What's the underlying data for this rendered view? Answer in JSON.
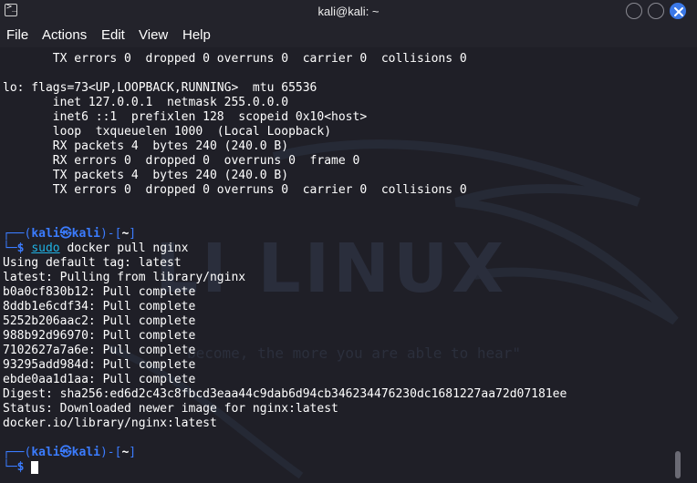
{
  "window": {
    "title": "kali@kali: ~",
    "icon": "terminal-icon"
  },
  "menu": [
    "File",
    "Actions",
    "Edit",
    "View",
    "Help"
  ],
  "watermark": {
    "text": "LI LINUX",
    "quote": "become, the more you are able to hear\""
  },
  "output_top": [
    "       TX errors 0  dropped 0 overruns 0  carrier 0  collisions 0",
    "",
    "lo: flags=73<UP,LOOPBACK,RUNNING>  mtu 65536",
    "       inet 127.0.0.1  netmask 255.0.0.0",
    "       inet6 ::1  prefixlen 128  scopeid 0x10<host>",
    "       loop  txqueuelen 1000  (Local Loopback)",
    "       RX packets 4  bytes 240 (240.0 B)",
    "       RX errors 0  dropped 0  overruns 0  frame 0",
    "       TX packets 4  bytes 240 (240.0 B)",
    "       TX errors 0  dropped 0 overruns 0  carrier 0  collisions 0",
    "",
    ""
  ],
  "prompt1": {
    "open": "┌──(",
    "user": "kali",
    "at": "㉿",
    "host": "kali",
    "close": ")-[",
    "dir": "~",
    "end": "]",
    "arrow": "└─",
    "dollar": "$ ",
    "sudo": "sudo",
    "command": " docker pull nginx"
  },
  "output_pull": [
    "Using default tag: latest",
    "latest: Pulling from library/nginx",
    "b0a0cf830b12: Pull complete",
    "8ddb1e6cdf34: Pull complete",
    "5252b206aac2: Pull complete",
    "988b92d96970: Pull complete",
    "7102627a7a6e: Pull complete",
    "93295add984d: Pull complete",
    "ebde0aa1d1aa: Pull complete",
    "Digest: sha256:ed6d2c43c8fbcd3eaa44c9dab6d94cb346234476230dc1681227aa72d07181ee",
    "Status: Downloaded newer image for nginx:latest",
    "docker.io/library/nginx:latest",
    ""
  ],
  "prompt2": {
    "open": "┌──(",
    "user": "kali",
    "at": "㉿",
    "host": "kali",
    "close": ")-[",
    "dir": "~",
    "end": "]",
    "arrow": "└─",
    "dollar": "$ "
  }
}
